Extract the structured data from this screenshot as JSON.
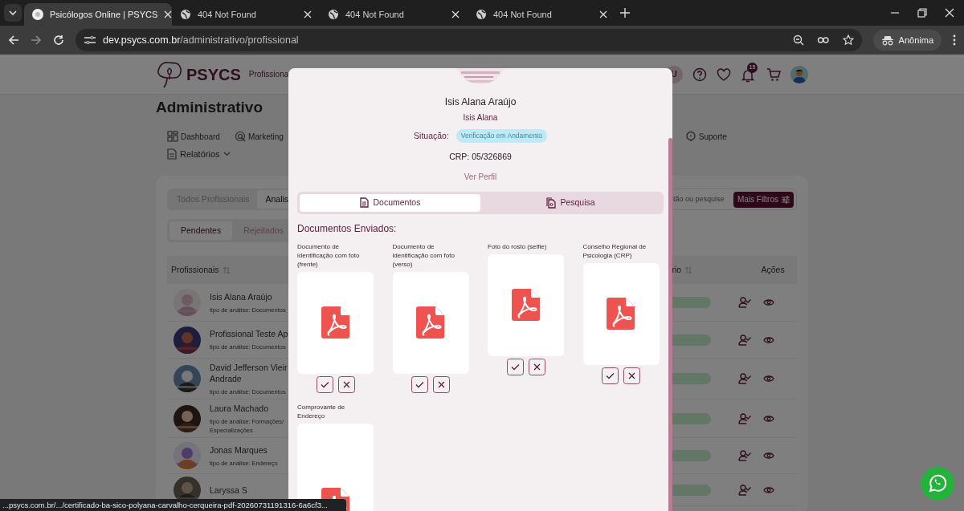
{
  "browser": {
    "tabs": [
      {
        "title": "Psicólogos Online | PSYCS",
        "selected": true
      },
      {
        "title": "404 Not Found",
        "selected": false
      },
      {
        "title": "404 Not Found",
        "selected": false
      },
      {
        "title": "404 Not Found",
        "selected": false
      }
    ],
    "url_host": "dev.psycs.com.br",
    "url_path": "/administrativo/profissional",
    "profile": "Anônima",
    "status_link": "...psycs.com.br/.../certificado-ba-sico-polyana-carvalho-cerqueira-pdf-20260731191316-6a6cf3..."
  },
  "header": {
    "logo": "PSYCS",
    "nav_label": "Profissiona",
    "user_initial": "U",
    "notification_count": "15"
  },
  "page": {
    "title": "Administrativo",
    "nav_row_1": [
      "Dashboard",
      "Marketing",
      "Suporte"
    ],
    "nav_row_2": [
      "Relatórios"
    ],
    "filter_tabs": [
      {
        "label": "Todos Profissionais",
        "selected": false
      },
      {
        "label": "Analis",
        "selected": true
      }
    ],
    "search": {
      "placeholder": "tão ou pesquise"
    },
    "filters_button": "Mais Filtros",
    "status_tabs": [
      {
        "label": "Pendentes",
        "selected": true
      },
      {
        "label": "Rejeitados",
        "selected": false
      }
    ],
    "table": {
      "columns": [
        {
          "label": "Profissionais",
          "sortable": true
        },
        {
          "label": "rio",
          "sortable": true
        },
        {
          "label": "Ações",
          "sortable": false
        }
      ],
      "rows": [
        {
          "name": "Isis Alana Araújo",
          "subtitle": "tipo de análise: Documentos"
        },
        {
          "name": "Profissional Teste Ap",
          "subtitle": "tipo de análise: Documentos"
        },
        {
          "name": "David Jefferson Vieir Andrade",
          "subtitle": "tipo de análise: Documentos"
        },
        {
          "name": "Laura Machado",
          "subtitle": "tipo de análise: Formações/ Especializações"
        },
        {
          "name": "Jonas Marques",
          "subtitle": "tipo de análise: Endereço"
        },
        {
          "name": "Laryssa S"
        }
      ]
    }
  },
  "modal": {
    "name": "Isis Alana Araújo",
    "nickname": "Isis Alana",
    "status_label": "Situação:",
    "status": "Verificação em Andamento",
    "crp": "CRP: 05/326869",
    "profile_link": "Ver Perfil",
    "tabs": [
      {
        "label": "Documentos",
        "selected": true
      },
      {
        "label": "Pesquisa",
        "selected": false
      }
    ],
    "section_title": "Documentos Enviados:",
    "documents": [
      {
        "label": "Documento de identificação com foto (frente)",
        "actions": true
      },
      {
        "label": "Documento de identificação com foto (verso)",
        "actions": true
      },
      {
        "label": "Foto do rosto (selfie)",
        "actions": true
      },
      {
        "label": "Conselho Regional de Psicologia (CRP)",
        "actions": true
      },
      {
        "label": "Comprovante de Endereço",
        "actions": false
      }
    ]
  }
}
